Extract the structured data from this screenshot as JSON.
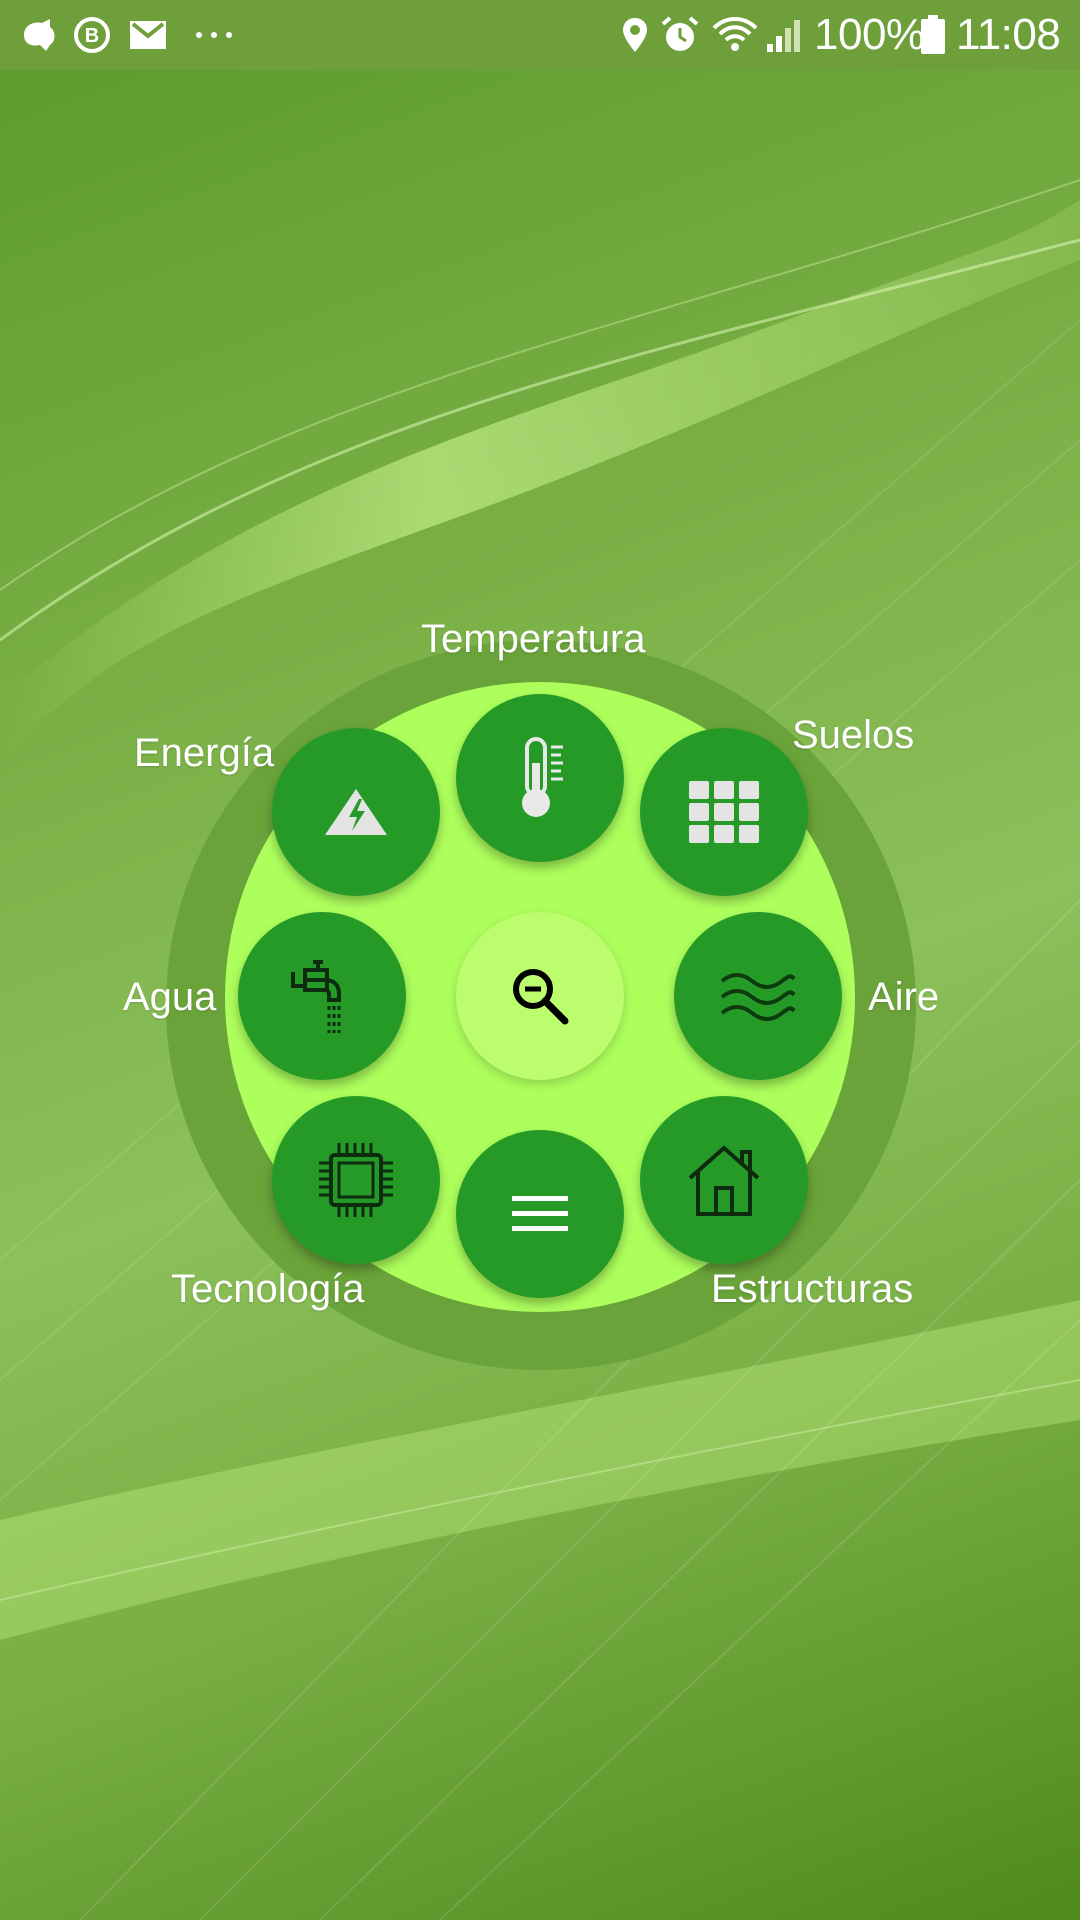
{
  "status_bar": {
    "icons_left": [
      "android-notification-icon",
      "whatsapp-business-icon",
      "gmail-icon",
      "more-notifications-icon"
    ],
    "icons_right": [
      "location-icon",
      "alarm-icon",
      "wifi-icon",
      "signal-icon"
    ],
    "battery_percent": "100%",
    "time": "11:08"
  },
  "menu": {
    "center_action": "zoom-out-icon",
    "items": [
      {
        "label": "Temperatura",
        "icon": "thermometer-icon"
      },
      {
        "label": "Suelos",
        "icon": "grid-icon"
      },
      {
        "label": "Aire",
        "icon": "waves-icon"
      },
      {
        "label": "Estructuras",
        "icon": "house-icon"
      },
      {
        "label": "Tecnología",
        "icon": "chip-icon"
      },
      {
        "label": "Agua",
        "icon": "faucet-icon"
      },
      {
        "label": "Energía",
        "icon": "energy-mountain-icon"
      }
    ],
    "bottom_action": "hamburger-menu-icon"
  },
  "colors": {
    "button": "#259a27",
    "inner_disc": "#adff5c",
    "outer_ring": "#6aa33a",
    "center_button": "#bcfd6e"
  }
}
